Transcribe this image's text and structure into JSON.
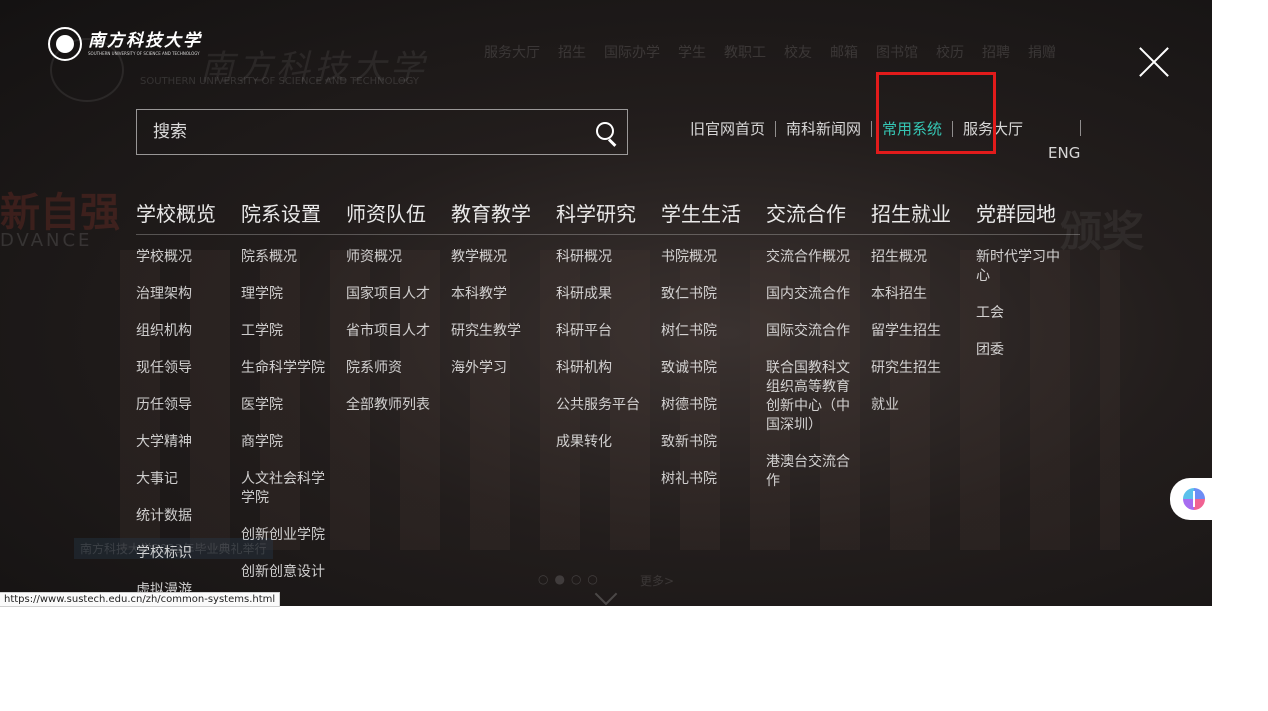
{
  "logo": {
    "cn": "南方科技大学",
    "en": "SOUTHERN UNIVERSITY OF SCIENCE AND TECHNOLOGY"
  },
  "background": {
    "ghost_nav": [
      "服务大厅",
      "招生",
      "国际办学",
      "学生",
      "教职工",
      "校友",
      "邮箱",
      "图书馆",
      "校历",
      "招聘",
      "捐赠"
    ],
    "quote": "新自强",
    "quote_en": "DVANCE",
    "right_text": "颁奖",
    "caption": "南方科技大学2023年毕业典礼举行",
    "more": "更多>"
  },
  "search": {
    "placeholder": "搜索"
  },
  "quick_links": [
    "旧官网首页",
    "南科新闻网",
    "常用系统",
    "服务大厅"
  ],
  "lang": "ENG",
  "colors": {
    "accent": "#35c6b4",
    "highlight": "#e21b1b"
  },
  "nav": [
    {
      "title": "学校概览",
      "items": [
        "学校概况",
        "治理架构",
        "组织机构",
        "现任领导",
        "历任领导",
        "大学精神",
        "大事记",
        "统计数据",
        "学校标识",
        "虚拟漫游"
      ]
    },
    {
      "title": "院系设置",
      "items": [
        "院系概况",
        "理学院",
        "工学院",
        "生命科学学院",
        "医学院",
        "商学院",
        "人文社会科学学院",
        "创新创业学院",
        "创新创意设计"
      ]
    },
    {
      "title": "师资队伍",
      "items": [
        "师资概况",
        "国家项目人才",
        "省市项目人才",
        "院系师资",
        "全部教师列表"
      ]
    },
    {
      "title": "教育教学",
      "items": [
        "教学概况",
        "本科教学",
        "研究生教学",
        "海外学习"
      ]
    },
    {
      "title": "科学研究",
      "items": [
        "科研概况",
        "科研成果",
        "科研平台",
        "科研机构",
        "公共服务平台",
        "成果转化"
      ]
    },
    {
      "title": "学生生活",
      "items": [
        "书院概况",
        "致仁书院",
        "树仁书院",
        "致诚书院",
        "树德书院",
        "致新书院",
        "树礼书院"
      ]
    },
    {
      "title": "交流合作",
      "items": [
        "交流合作概况",
        "国内交流合作",
        "国际交流合作",
        "联合国教科文组织高等教育创新中心（中国深圳）",
        "港澳台交流合作"
      ]
    },
    {
      "title": "招生就业",
      "items": [
        "招生概况",
        "本科招生",
        "留学生招生",
        "研究生招生",
        "就业"
      ]
    },
    {
      "title": "党群园地",
      "items": [
        "新时代学习中心",
        "工会",
        "团委"
      ]
    }
  ],
  "status_url": "https://www.sustech.edu.cn/zh/common-systems.html"
}
